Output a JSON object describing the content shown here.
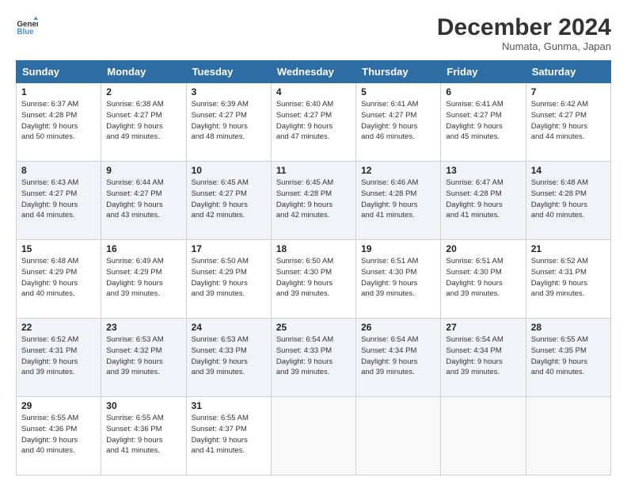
{
  "header": {
    "logo_line1": "General",
    "logo_line2": "Blue",
    "month": "December 2024",
    "location": "Numata, Gunma, Japan"
  },
  "days_of_week": [
    "Sunday",
    "Monday",
    "Tuesday",
    "Wednesday",
    "Thursday",
    "Friday",
    "Saturday"
  ],
  "weeks": [
    [
      {
        "day": "1",
        "info": "Sunrise: 6:37 AM\nSunset: 4:28 PM\nDaylight: 9 hours\nand 50 minutes."
      },
      {
        "day": "2",
        "info": "Sunrise: 6:38 AM\nSunset: 4:27 PM\nDaylight: 9 hours\nand 49 minutes."
      },
      {
        "day": "3",
        "info": "Sunrise: 6:39 AM\nSunset: 4:27 PM\nDaylight: 9 hours\nand 48 minutes."
      },
      {
        "day": "4",
        "info": "Sunrise: 6:40 AM\nSunset: 4:27 PM\nDaylight: 9 hours\nand 47 minutes."
      },
      {
        "day": "5",
        "info": "Sunrise: 6:41 AM\nSunset: 4:27 PM\nDaylight: 9 hours\nand 46 minutes."
      },
      {
        "day": "6",
        "info": "Sunrise: 6:41 AM\nSunset: 4:27 PM\nDaylight: 9 hours\nand 45 minutes."
      },
      {
        "day": "7",
        "info": "Sunrise: 6:42 AM\nSunset: 4:27 PM\nDaylight: 9 hours\nand 44 minutes."
      }
    ],
    [
      {
        "day": "8",
        "info": "Sunrise: 6:43 AM\nSunset: 4:27 PM\nDaylight: 9 hours\nand 44 minutes."
      },
      {
        "day": "9",
        "info": "Sunrise: 6:44 AM\nSunset: 4:27 PM\nDaylight: 9 hours\nand 43 minutes."
      },
      {
        "day": "10",
        "info": "Sunrise: 6:45 AM\nSunset: 4:27 PM\nDaylight: 9 hours\nand 42 minutes."
      },
      {
        "day": "11",
        "info": "Sunrise: 6:45 AM\nSunset: 4:28 PM\nDaylight: 9 hours\nand 42 minutes."
      },
      {
        "day": "12",
        "info": "Sunrise: 6:46 AM\nSunset: 4:28 PM\nDaylight: 9 hours\nand 41 minutes."
      },
      {
        "day": "13",
        "info": "Sunrise: 6:47 AM\nSunset: 4:28 PM\nDaylight: 9 hours\nand 41 minutes."
      },
      {
        "day": "14",
        "info": "Sunrise: 6:48 AM\nSunset: 4:28 PM\nDaylight: 9 hours\nand 40 minutes."
      }
    ],
    [
      {
        "day": "15",
        "info": "Sunrise: 6:48 AM\nSunset: 4:29 PM\nDaylight: 9 hours\nand 40 minutes."
      },
      {
        "day": "16",
        "info": "Sunrise: 6:49 AM\nSunset: 4:29 PM\nDaylight: 9 hours\nand 39 minutes."
      },
      {
        "day": "17",
        "info": "Sunrise: 6:50 AM\nSunset: 4:29 PM\nDaylight: 9 hours\nand 39 minutes."
      },
      {
        "day": "18",
        "info": "Sunrise: 6:50 AM\nSunset: 4:30 PM\nDaylight: 9 hours\nand 39 minutes."
      },
      {
        "day": "19",
        "info": "Sunrise: 6:51 AM\nSunset: 4:30 PM\nDaylight: 9 hours\nand 39 minutes."
      },
      {
        "day": "20",
        "info": "Sunrise: 6:51 AM\nSunset: 4:30 PM\nDaylight: 9 hours\nand 39 minutes."
      },
      {
        "day": "21",
        "info": "Sunrise: 6:52 AM\nSunset: 4:31 PM\nDaylight: 9 hours\nand 39 minutes."
      }
    ],
    [
      {
        "day": "22",
        "info": "Sunrise: 6:52 AM\nSunset: 4:31 PM\nDaylight: 9 hours\nand 39 minutes."
      },
      {
        "day": "23",
        "info": "Sunrise: 6:53 AM\nSunset: 4:32 PM\nDaylight: 9 hours\nand 39 minutes."
      },
      {
        "day": "24",
        "info": "Sunrise: 6:53 AM\nSunset: 4:33 PM\nDaylight: 9 hours\nand 39 minutes."
      },
      {
        "day": "25",
        "info": "Sunrise: 6:54 AM\nSunset: 4:33 PM\nDaylight: 9 hours\nand 39 minutes."
      },
      {
        "day": "26",
        "info": "Sunrise: 6:54 AM\nSunset: 4:34 PM\nDaylight: 9 hours\nand 39 minutes."
      },
      {
        "day": "27",
        "info": "Sunrise: 6:54 AM\nSunset: 4:34 PM\nDaylight: 9 hours\nand 39 minutes."
      },
      {
        "day": "28",
        "info": "Sunrise: 6:55 AM\nSunset: 4:35 PM\nDaylight: 9 hours\nand 40 minutes."
      }
    ],
    [
      {
        "day": "29",
        "info": "Sunrise: 6:55 AM\nSunset: 4:36 PM\nDaylight: 9 hours\nand 40 minutes."
      },
      {
        "day": "30",
        "info": "Sunrise: 6:55 AM\nSunset: 4:36 PM\nDaylight: 9 hours\nand 41 minutes."
      },
      {
        "day": "31",
        "info": "Sunrise: 6:55 AM\nSunset: 4:37 PM\nDaylight: 9 hours\nand 41 minutes."
      },
      null,
      null,
      null,
      null
    ]
  ]
}
